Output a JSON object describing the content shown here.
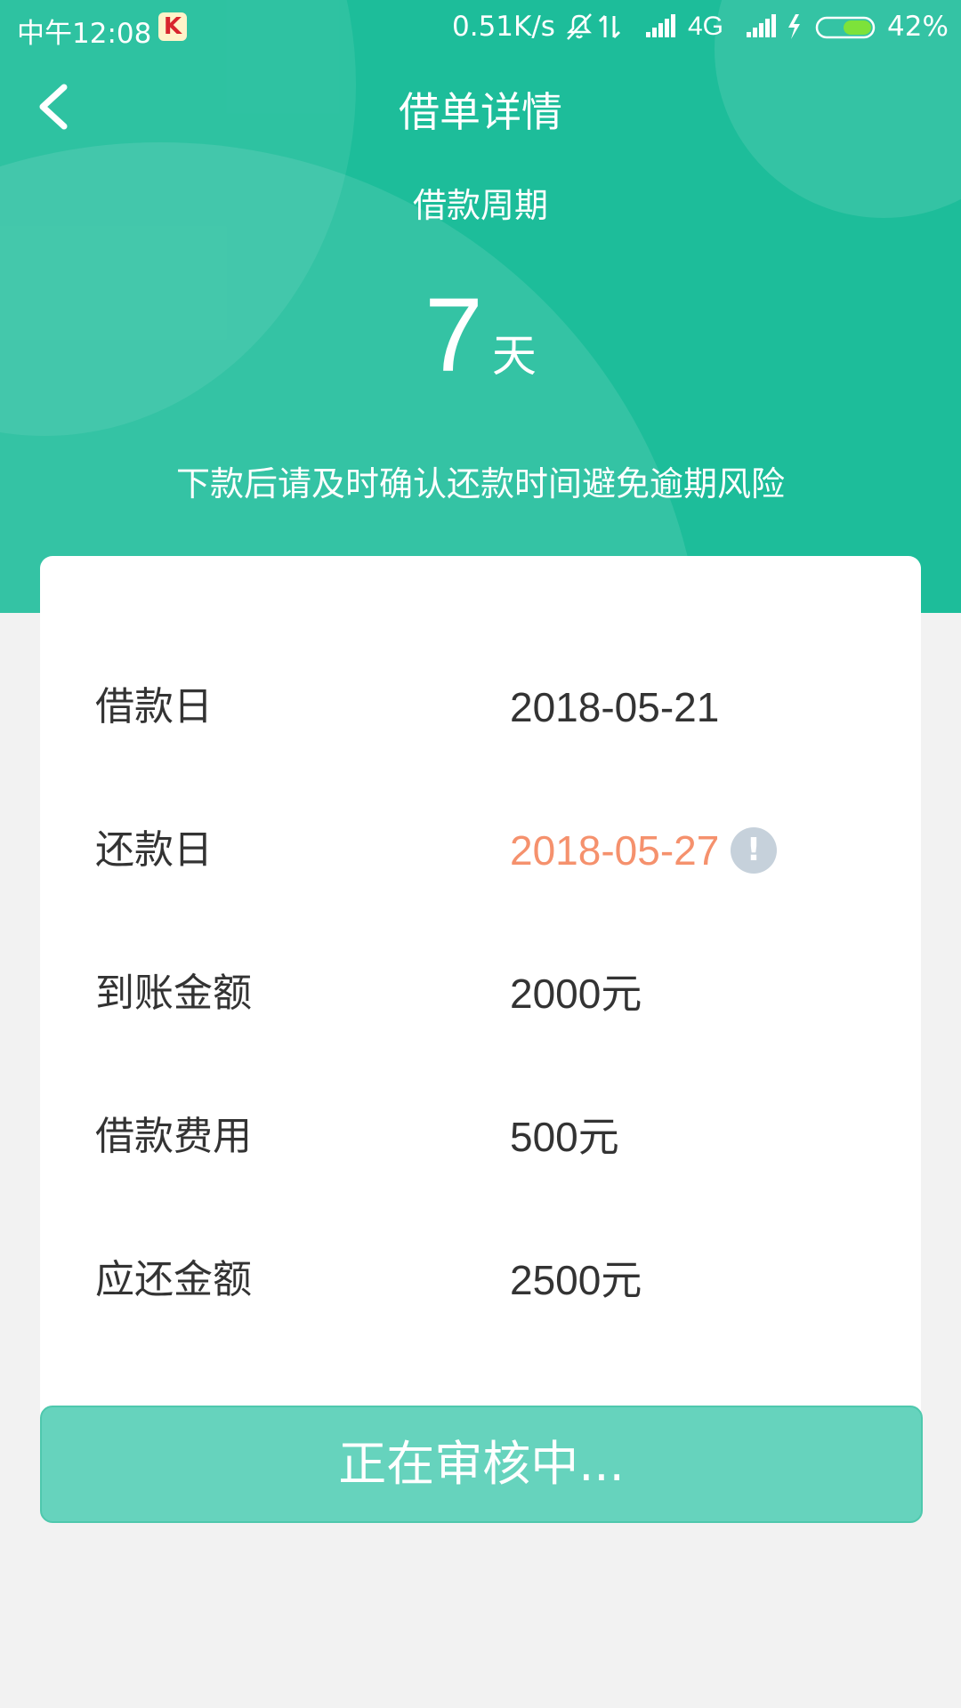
{
  "status_bar": {
    "time": "中午12:08",
    "net_speed": "0.51K/s",
    "network_type": "4G",
    "battery": "42%",
    "icons": [
      "app-notification-icon",
      "mute-icon",
      "data-transfer-icon",
      "signal-icon",
      "signal-icon",
      "charging-icon",
      "battery-icon"
    ]
  },
  "header": {
    "title": "借单详情",
    "cycle_label": "借款周期",
    "cycle_value": "7",
    "cycle_unit": "天",
    "hint": "下款后请及时确认还款时间避免逾期风险"
  },
  "details": {
    "rows": [
      {
        "label": "借款日",
        "value": "2018-05-21"
      },
      {
        "label": "还款日",
        "value": "2018-05-27"
      },
      {
        "label": "到账金额",
        "value": "2000元"
      },
      {
        "label": "借款费用",
        "value": "500元"
      },
      {
        "label": "应还金额",
        "value": "2500元"
      }
    ]
  },
  "status_button": {
    "label": "正在审核中..."
  },
  "colors": {
    "header_bg": "#1dbd9a",
    "due_date": "#f5916d",
    "button_bg": "#66d3bd",
    "page_bg": "#f2f2f2"
  }
}
